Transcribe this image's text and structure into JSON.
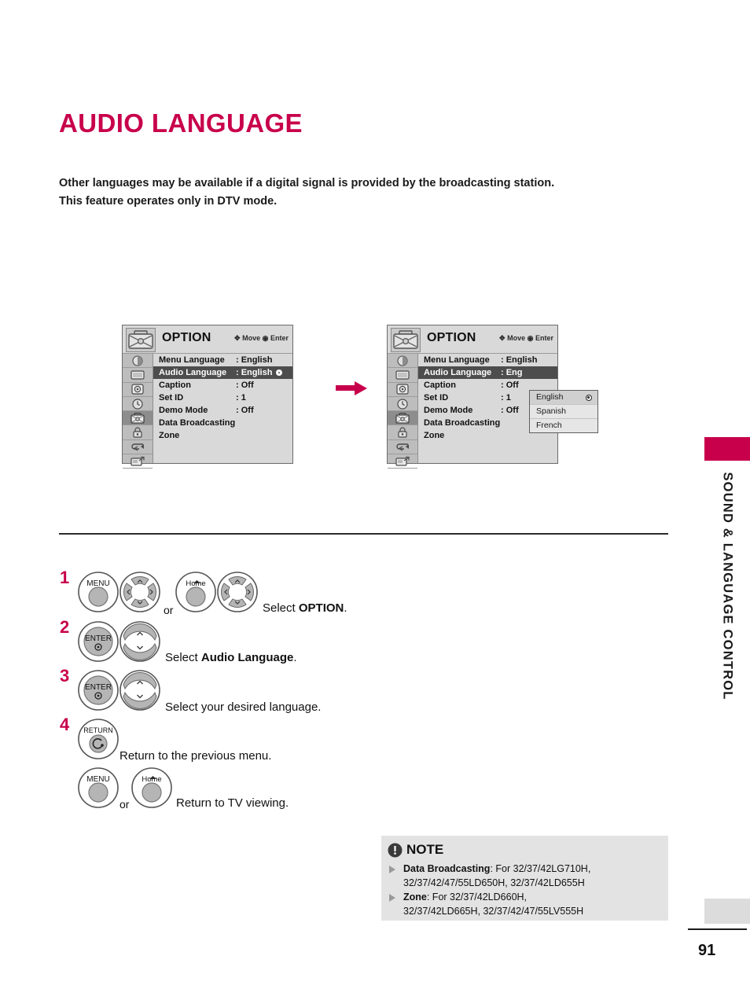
{
  "heading": "AUDIO LANGUAGE",
  "intro": "Other languages may be available if a digital signal is provided by the broadcasting station.\nThis feature operates only in DTV mode.",
  "osd": {
    "title": "OPTION",
    "hint_move": "Move",
    "hint_enter": "Enter",
    "rows": [
      {
        "label": "Menu Language",
        "value": ": English"
      },
      {
        "label": "Audio Language",
        "value": ": English"
      },
      {
        "label": "Caption",
        "value": ": Off"
      },
      {
        "label": "Set ID",
        "value": ": 1"
      },
      {
        "label": "Demo Mode",
        "value": ": Off"
      },
      {
        "label": "Data Broadcasting",
        "value": ""
      },
      {
        "label": "Zone",
        "value": ""
      }
    ],
    "highlighted_row": "Audio Language",
    "rail_icons": [
      "picture-icon",
      "screen-icon",
      "audio-icon",
      "time-icon",
      "option-icon",
      "lock-icon",
      "input-icon",
      "usb-icon"
    ],
    "second_audio_value": ": Eng",
    "dropdown": {
      "options": [
        "English",
        "Spanish",
        "French"
      ],
      "selected": "English"
    }
  },
  "steps": [
    {
      "num": "1",
      "buttons": [
        "MENU",
        "nav-wheel",
        "Home",
        "nav-wheel"
      ],
      "or_label": "or",
      "caption_prefix": "Select ",
      "caption_bold": "OPTION",
      "caption_suffix": "."
    },
    {
      "num": "2",
      "buttons": [
        "ENTER",
        "updown"
      ],
      "caption_prefix": "Select ",
      "caption_bold": "Audio Language",
      "caption_suffix": "."
    },
    {
      "num": "3",
      "buttons": [
        "ENTER",
        "updown"
      ],
      "caption_prefix": "Select your desired language.",
      "caption_bold": "",
      "caption_suffix": ""
    },
    {
      "num": "4",
      "buttons": [
        "RETURN"
      ],
      "caption_prefix": "Return to the previous menu.",
      "caption_bold": "",
      "caption_suffix": ""
    }
  ],
  "step4_extra": {
    "buttons": [
      "MENU",
      "Home"
    ],
    "or_label": "or",
    "caption": "Return to TV viewing."
  },
  "button_labels": {
    "menu": "MENU",
    "home": "Home",
    "enter": "ENTER",
    "return": "RETURN"
  },
  "note": {
    "title": "NOTE",
    "items": [
      {
        "term": "Data Broadcasting",
        "text": ": For 32/37/42LG710H,",
        "text2": "32/37/42/47/55LD650H, 32/37/42LD655H"
      },
      {
        "term": "Zone",
        "text": ": For 32/37/42LD660H,",
        "text2": "32/37/42LD665H, 32/37/42/47/55LV555H"
      }
    ]
  },
  "sidebar_tab": "SOUND & LANGUAGE CONTROL",
  "page_number": "91",
  "colors": {
    "accent": "#c8004b",
    "osd_bg": "#d9d9d9",
    "osd_highlight": "#4d4d4d",
    "note_bg": "#e3e3e3"
  }
}
